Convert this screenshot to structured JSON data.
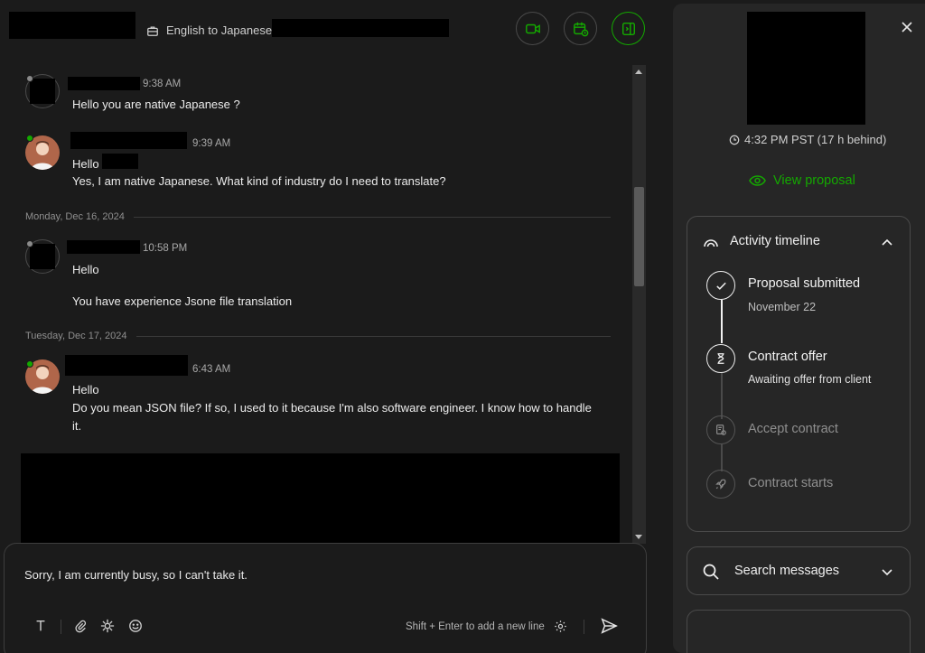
{
  "header": {
    "subtitle": "English to Japanese",
    "buttons": [
      "video-call",
      "schedule",
      "toggle-panel"
    ]
  },
  "messages": [
    {
      "time": "9:38 AM",
      "lines": [
        "Hello you are native Japanese ?"
      ],
      "online": false
    },
    {
      "time": "9:39 AM",
      "lines": [
        "Hello",
        "Yes, I am native Japanese. What kind of industry do I need to translate?"
      ],
      "online": true
    },
    {
      "divider": "Monday, Dec 16, 2024"
    },
    {
      "time": "10:58 PM",
      "lines": [
        "Hello",
        "You have experience Jsone file translation"
      ],
      "online": false
    },
    {
      "divider": "Tuesday, Dec 17, 2024"
    },
    {
      "time": "6:43 AM",
      "lines": [
        "Hello",
        "Do you mean JSON file? If so, I used to it because I'm also software engineer. I know how to handle",
        "it."
      ],
      "online": true
    }
  ],
  "composer": {
    "value": "Sorry, I am currently busy, so I can't take it.",
    "hint": "Shift + Enter to add a new line"
  },
  "panel": {
    "local_time": "4:32 PM PST (17 h behind)",
    "view_proposal": "View proposal",
    "timeline_title": "Activity timeline",
    "steps": [
      {
        "title": "Proposal submitted",
        "sub": "November 22",
        "state": "done"
      },
      {
        "title": "Contract offer",
        "sub": "Awaiting offer from client",
        "state": "current"
      },
      {
        "title": "Accept contract",
        "sub": "",
        "state": "todo"
      },
      {
        "title": "Contract starts",
        "sub": "",
        "state": "todo"
      }
    ],
    "search_label": "Search messages"
  },
  "colors": {
    "accent": "#14a800",
    "background": "#1b1b1b",
    "panel": "#262626"
  }
}
